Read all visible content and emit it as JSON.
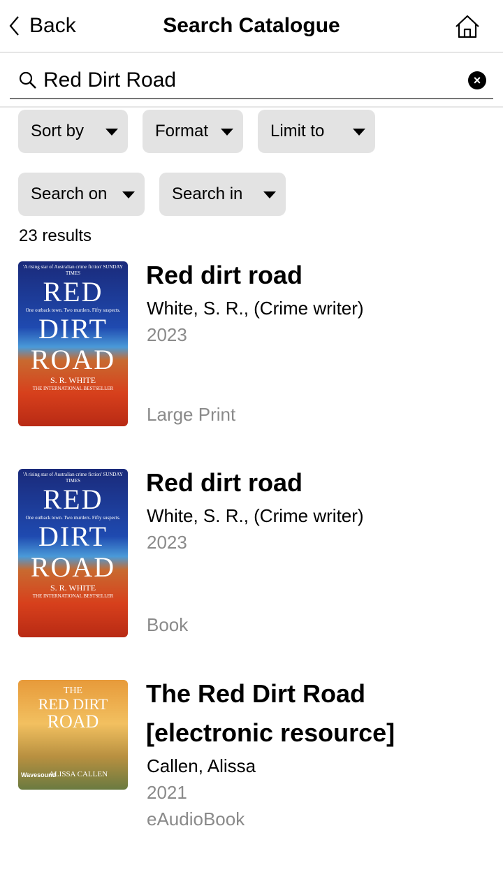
{
  "nav": {
    "back_label": "Back",
    "title": "Search Catalogue"
  },
  "search": {
    "value": "Red Dirt Road"
  },
  "filters": [
    {
      "label": "Sort by"
    },
    {
      "label": "Format"
    },
    {
      "label": "Limit to"
    },
    {
      "label": "Search on"
    },
    {
      "label": "Search in"
    }
  ],
  "results_count": "23 results",
  "results": [
    {
      "title": "Red dirt road",
      "author": "White, S. R., (Crime writer)",
      "year": "2023",
      "format": "Large Print",
      "cover": {
        "quote": "'A rising star of Australian crime fiction' SUNDAY TIMES",
        "line1": "RED",
        "tagline": "One outback town. Two murders. Fifty suspects.",
        "line2": "DIRT",
        "line3": "ROAD",
        "author": "S. R. WHITE",
        "footer": "THE INTERNATIONAL BESTSELLER"
      }
    },
    {
      "title": "Red dirt road",
      "author": "White, S. R., (Crime writer)",
      "year": "2023",
      "format": "Book",
      "cover": {
        "quote": "'A rising star of Australian crime fiction' SUNDAY TIMES",
        "line1": "RED",
        "tagline": "One outback town. Two murders. Fifty suspects.",
        "line2": "DIRT",
        "line3": "ROAD",
        "author": "S. R. WHITE",
        "footer": "THE INTERNATIONAL BESTSELLER"
      }
    },
    {
      "title": "The Red Dirt Road [electronic resource]",
      "author": "Callen, Alissa",
      "year": "2021",
      "format": "eAudioBook",
      "cover": {
        "line1": "THE",
        "line2": "RED DIRT",
        "line3": "ROAD",
        "author": "ALISSA CALLEN",
        "publisher": "Wavesound"
      }
    }
  ]
}
